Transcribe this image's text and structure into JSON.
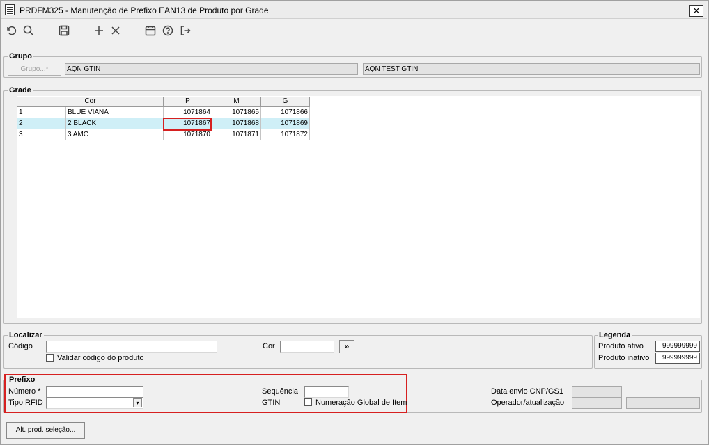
{
  "window": {
    "title": "PRDFM325 - Manutenção de Prefixo EAN13 de Produto por Grade",
    "close_glyph": "✕"
  },
  "toolbar": {
    "icons": [
      "undo-icon",
      "search-icon",
      "save-icon",
      "add-icon",
      "delete-icon",
      "calendar-icon",
      "help-icon",
      "exit-icon"
    ]
  },
  "grupo": {
    "title": "Grupo",
    "button_label": "Grupo...*",
    "code_value": "AQN GTIN",
    "description_value": "AQN TEST GTIN"
  },
  "grade": {
    "title": "Grade",
    "columns": [
      "Cor",
      "P",
      "M",
      "G"
    ],
    "rows": [
      {
        "num": "1",
        "cor": "BLUE VIANA",
        "p": "1071864",
        "m": "1071865",
        "g": "1071866"
      },
      {
        "num": "2",
        "cor": "2 BLACK",
        "p": "1071867",
        "m": "1071868",
        "g": "1071869"
      },
      {
        "num": "3",
        "cor": "3 AMC",
        "p": "1071870",
        "m": "1071871",
        "g": "1071872"
      }
    ],
    "selected_row": 1,
    "selected_column": "P"
  },
  "localizar": {
    "title": "Localizar",
    "codigo_label": "Código",
    "codigo_value": "",
    "cor_label": "Cor",
    "cor_value": "",
    "go_button": "»",
    "validar_label": "Validar código do produto",
    "validar_checked": false
  },
  "legenda": {
    "title": "Legenda",
    "ativo_label": "Produto ativo",
    "ativo_value": "999999999",
    "inativo_label": "Produto inativo",
    "inativo_value": "999999999"
  },
  "prefixo": {
    "title": "Prefixo",
    "numero_label": "Número *",
    "numero_value": "",
    "tipo_rfid_label": "Tipo RFID",
    "tipo_rfid_value": "",
    "sequencia_label": "Sequência",
    "sequencia_value": "",
    "gtin_label": "GTIN",
    "gtin_checkbox_label": "Numeração Global de Item",
    "gtin_checked": false,
    "data_envio_label": "Data envio CNP/GS1",
    "data_envio_value": "",
    "operador_label": "Operador/atualização",
    "operador_value": "",
    "operador_value2": ""
  },
  "footer": {
    "alt_button_label": "Alt. prod. seleção..."
  },
  "colors": {
    "selection_row": "#cfeff7",
    "highlight_border": "#d62020",
    "readonly_field": "#e3e3e3"
  }
}
